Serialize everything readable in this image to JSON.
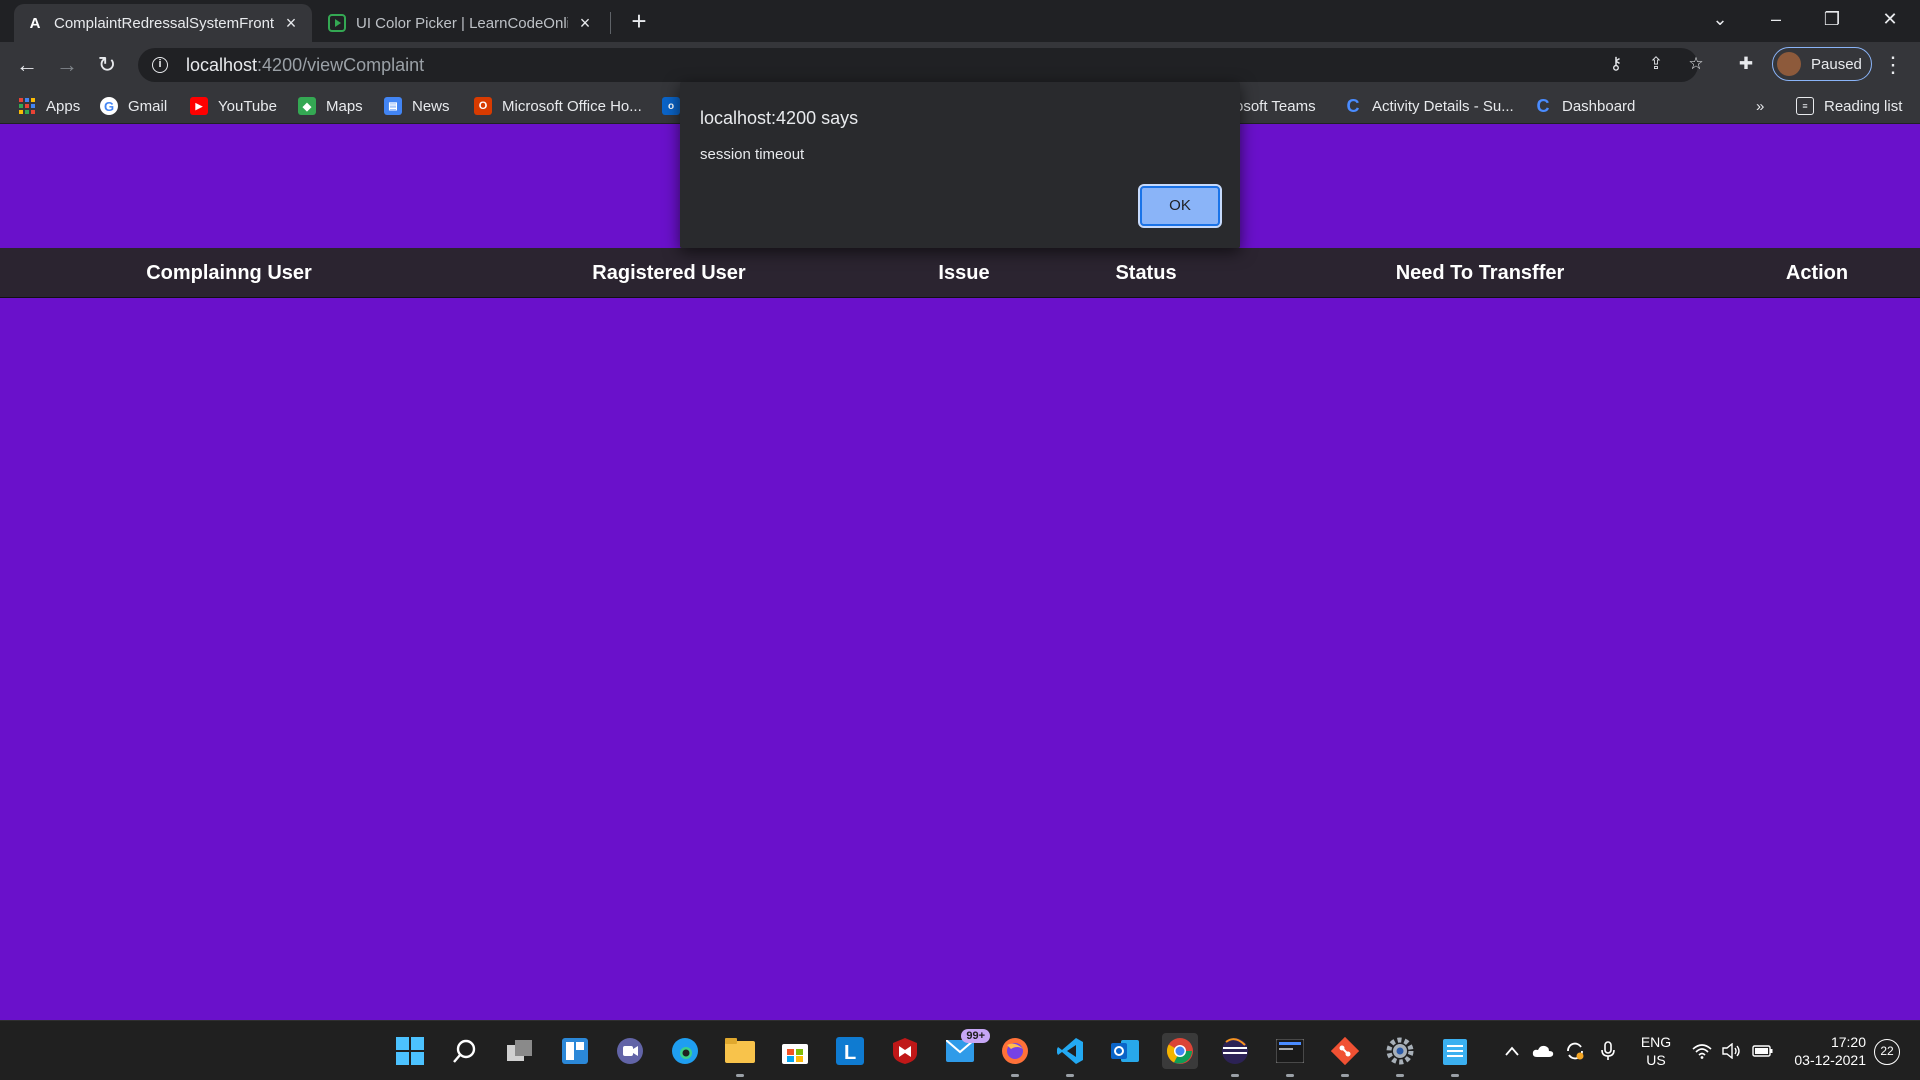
{
  "tabs": [
    {
      "title": "ComplaintRedressalSystemFrontend",
      "favicon": "angular-icon",
      "active": true
    },
    {
      "title": "UI Color Picker | LearnCodeOnline",
      "favicon": "lco-icon",
      "active": false
    }
  ],
  "omnibox": {
    "host": "localhost",
    "path": ":4200/viewComplaint"
  },
  "profile": {
    "label": "Paused"
  },
  "bookmarks": {
    "apps": "Apps",
    "gmail": "Gmail",
    "youtube": "YouTube",
    "maps": "Maps",
    "news": "News",
    "office": "Microsoft Office Ho...",
    "teams": "rosoft Teams",
    "activity": "Activity Details - Su...",
    "dashboard": "Dashboard",
    "more": "»",
    "reading_list": "Reading list"
  },
  "table": {
    "columns": [
      "Complainng User",
      "Ragistered User",
      "Issue",
      "Status",
      "Need To Transffer",
      "Action"
    ]
  },
  "dialog": {
    "title": "localhost:4200 says",
    "message": "session timeout",
    "ok_label": "OK"
  },
  "taskbar": {
    "mail_badge": "99+",
    "lang_top": "ENG",
    "lang_bottom": "US",
    "time": "17:20",
    "date": "03-12-2021",
    "notifications": "22"
  },
  "colors": {
    "page_bg": "#6a11cb",
    "table_header_bg": "#2b2430",
    "dialog_bg": "#292a2d",
    "ok_button": "#8ab4f8"
  }
}
